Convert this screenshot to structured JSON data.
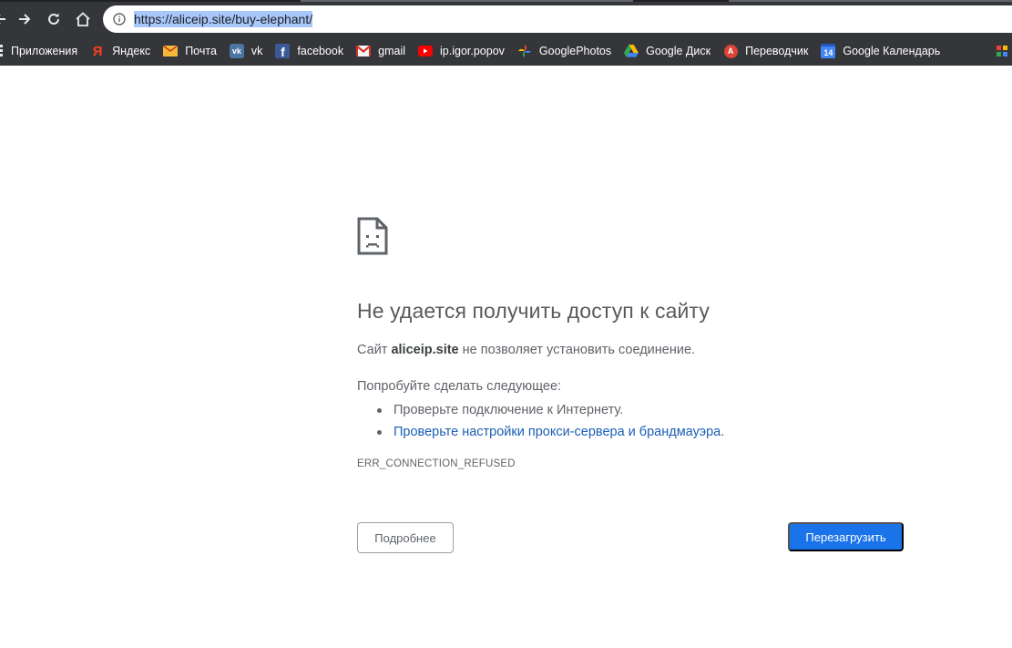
{
  "browser": {
    "address_bar": {
      "url": "https://aliceip.site/buy-elephant/"
    },
    "bookmarks": [
      {
        "label": "Приложения",
        "icon": "apps-grid-icon"
      },
      {
        "label": "Яндекс",
        "icon": "yandex-icon"
      },
      {
        "label": "Почта",
        "icon": "mail-envelope-icon"
      },
      {
        "label": "vk",
        "icon": "vk-icon"
      },
      {
        "label": "facebook",
        "icon": "facebook-icon"
      },
      {
        "label": "gmail",
        "icon": "gmail-icon"
      },
      {
        "label": "ip.igor.popov",
        "icon": "youtube-icon"
      },
      {
        "label": "GooglePhotos",
        "icon": "google-photos-icon"
      },
      {
        "label": "Google Диск",
        "icon": "google-drive-icon"
      },
      {
        "label": "Переводчик",
        "icon": "translate-icon"
      },
      {
        "label": "Google Календарь",
        "icon": "google-calendar-icon"
      }
    ],
    "calendar_day": "14",
    "translate_badge": "A",
    "yandex_letter": "Я",
    "vk_letters": "vk",
    "fb_letter": "f"
  },
  "error_page": {
    "title": "Не удается получить доступ к сайту",
    "description_prefix": "Сайт ",
    "description_host": "aliceip.site",
    "description_suffix": " не позволяет установить соединение.",
    "try_heading": "Попробуйте сделать следующее:",
    "suggestions": [
      "Проверьте подключение к Интернету.",
      "Проверьте настройки прокси-сервера и брандмауэра"
    ],
    "suggestion_2_period": ".",
    "error_code": "ERR_CONNECTION_REFUSED",
    "details_button": "Подробнее",
    "reload_button": "Перезагрузить"
  },
  "colors": {
    "chrome_bg": "#35363a",
    "link_blue": "#1a5fb4",
    "primary_button": "#1a73e8",
    "text_gray": "#5f6368"
  }
}
